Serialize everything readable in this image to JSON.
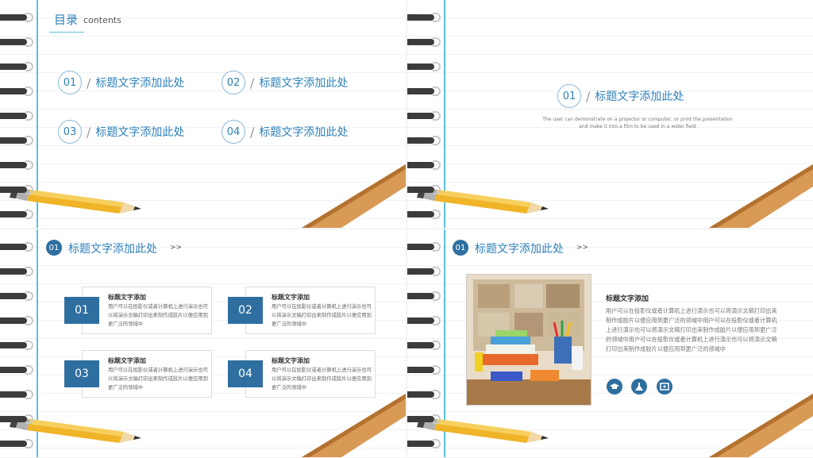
{
  "toc": {
    "title": "目录",
    "subtitle": "contents",
    "items": [
      {
        "num": "01",
        "label": "标题文字添加此处"
      },
      {
        "num": "02",
        "label": "标题文字添加此处"
      },
      {
        "num": "03",
        "label": "标题文字添加此处"
      },
      {
        "num": "04",
        "label": "标题文字添加此处"
      }
    ]
  },
  "section": {
    "num": "01",
    "title": "标题文字添加此处",
    "desc_line1": "The user can demonstrate on a projector or computer, or print the presentation",
    "desc_line2": "and make it into a film to be used in a wider field"
  },
  "slide3": {
    "head_num": "01",
    "head_title": "标题文字添加此处",
    "head_arrow": ">>",
    "boxes": [
      {
        "num": "01",
        "title": "标题文字添加",
        "text": "用户可以在投影仪或者计算机上进行演示也可以将演示文稿打印出来制作成胶片以便应用到更广泛的领域中"
      },
      {
        "num": "02",
        "title": "标题文字添加",
        "text": "用户可以在投影仪或者计算机上进行演示也可以将演示文稿打印出来制作成胶片以便应用到更广泛的领域中"
      },
      {
        "num": "03",
        "title": "标题文字添加",
        "text": "用户可以在投影仪或者计算机上进行演示也可以将演示文稿打印出来制作成胶片以便应用到更广泛的领域中"
      },
      {
        "num": "04",
        "title": "标题文字添加",
        "text": "用户可以在投影仪或者计算机上进行演示也可以将演示文稿打印出来制作成胶片以便应用到更广泛的领域中"
      }
    ]
  },
  "slide4": {
    "head_num": "01",
    "head_title": "标题文字添加此处",
    "head_arrow": ">>",
    "content_title": "标题文字添加",
    "content_text": "用户可以在投影仪或者计算机上进行演示也可以将演示文稿打印出来制作成胶片以便应用到更广泛的领域中用户可以在投影仪或者计算机上进行演示也可以将演示文稿打印出来制作成胶片以便应用到更广泛的领域中用户可以在投影仪或者计算机上进行演示也可以将演示文稿打印出来制作成胶片以便应用到更广泛的领域中",
    "icons": [
      "graduation-cap-icon",
      "flask-icon",
      "certificate-icon"
    ]
  },
  "colors": {
    "accent": "#2e6fa0",
    "margin_line": "#5bc0de",
    "title_text": "#2e80b8"
  }
}
